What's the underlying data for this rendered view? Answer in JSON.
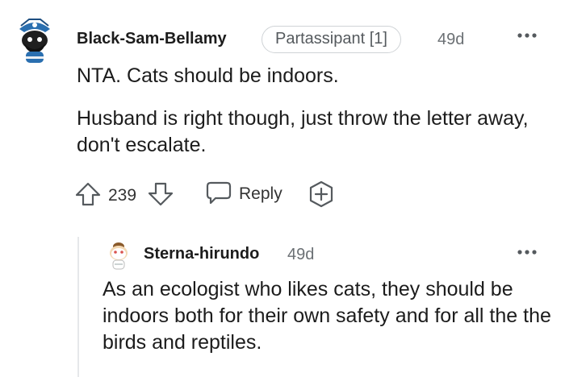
{
  "comment": {
    "username": "Black-Sam-Bellamy",
    "flair": "Partassipant [1]",
    "age": "49d",
    "paragraphs": [
      "NTA. Cats should be indoors.",
      "Husband is right though, just throw the letter away, don't escalate."
    ],
    "score": "239",
    "reply_label": "Reply",
    "icons": {
      "avatar": "pirate-snoo-avatar-icon",
      "more": "more-options-icon",
      "upvote": "upvote-arrow-icon",
      "downvote": "downvote-arrow-icon",
      "reply": "speech-bubble-icon",
      "award": "award-plus-icon"
    }
  },
  "reply": {
    "username": "Sterna-hirundo",
    "age": "49d",
    "paragraphs": [
      "As an ecologist who likes cats, they should be indoors both for their own safety and for all the the birds and reptiles."
    ],
    "icons": {
      "avatar": "snoo-avatar-icon",
      "more": "more-options-icon"
    }
  },
  "colors": {
    "text": "#1c1c1c",
    "meta": "#6b7074",
    "icon": "#555a5e",
    "thread_line": "#e6e8ea"
  }
}
